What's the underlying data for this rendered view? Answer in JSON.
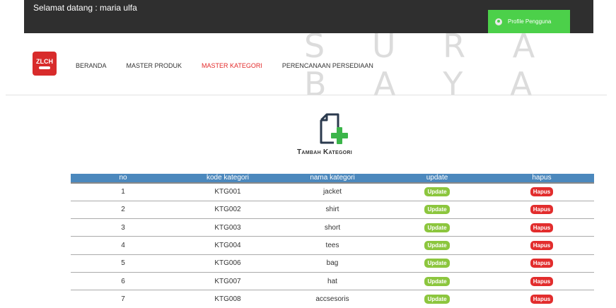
{
  "watermark": "S U R A B A Y A",
  "header": {
    "welcome": "Selamat datang : maria ulfa",
    "profile_label": "Profile Pengguna"
  },
  "logo_text": "ZLCH",
  "nav": [
    {
      "label": "BERANDA",
      "active": false
    },
    {
      "label": "MASTER PRODUK",
      "active": false
    },
    {
      "label": "MASTER KATEGORI",
      "active": true
    },
    {
      "label": "PERENCANAAN PERSEDIAAN",
      "active": false
    }
  ],
  "add_action": {
    "label": "Tambah Kategori",
    "icon": "file-add-icon"
  },
  "table": {
    "columns": [
      "no",
      "kode kategori",
      "nama kategori",
      "update",
      "hapus"
    ],
    "update_label": "Update",
    "hapus_label": "Hapus",
    "rows": [
      {
        "no": "1",
        "kode": "KTG001",
        "nama": "jacket"
      },
      {
        "no": "2",
        "kode": "KTG002",
        "nama": "shirt"
      },
      {
        "no": "3",
        "kode": "KTG003",
        "nama": "short"
      },
      {
        "no": "4",
        "kode": "KTG004",
        "nama": "tees"
      },
      {
        "no": "5",
        "kode": "KTG006",
        "nama": "bag"
      },
      {
        "no": "6",
        "kode": "KTG007",
        "nama": "hat"
      },
      {
        "no": "7",
        "kode": "KTG008",
        "nama": "accsesoris"
      }
    ]
  },
  "colors": {
    "topbar": "#2f2f2f",
    "profile": "#4cd04a",
    "header_row": "#4b88bd",
    "update": "#8cc63e",
    "hapus": "#e22d2d",
    "accent": "#e32b2b"
  }
}
